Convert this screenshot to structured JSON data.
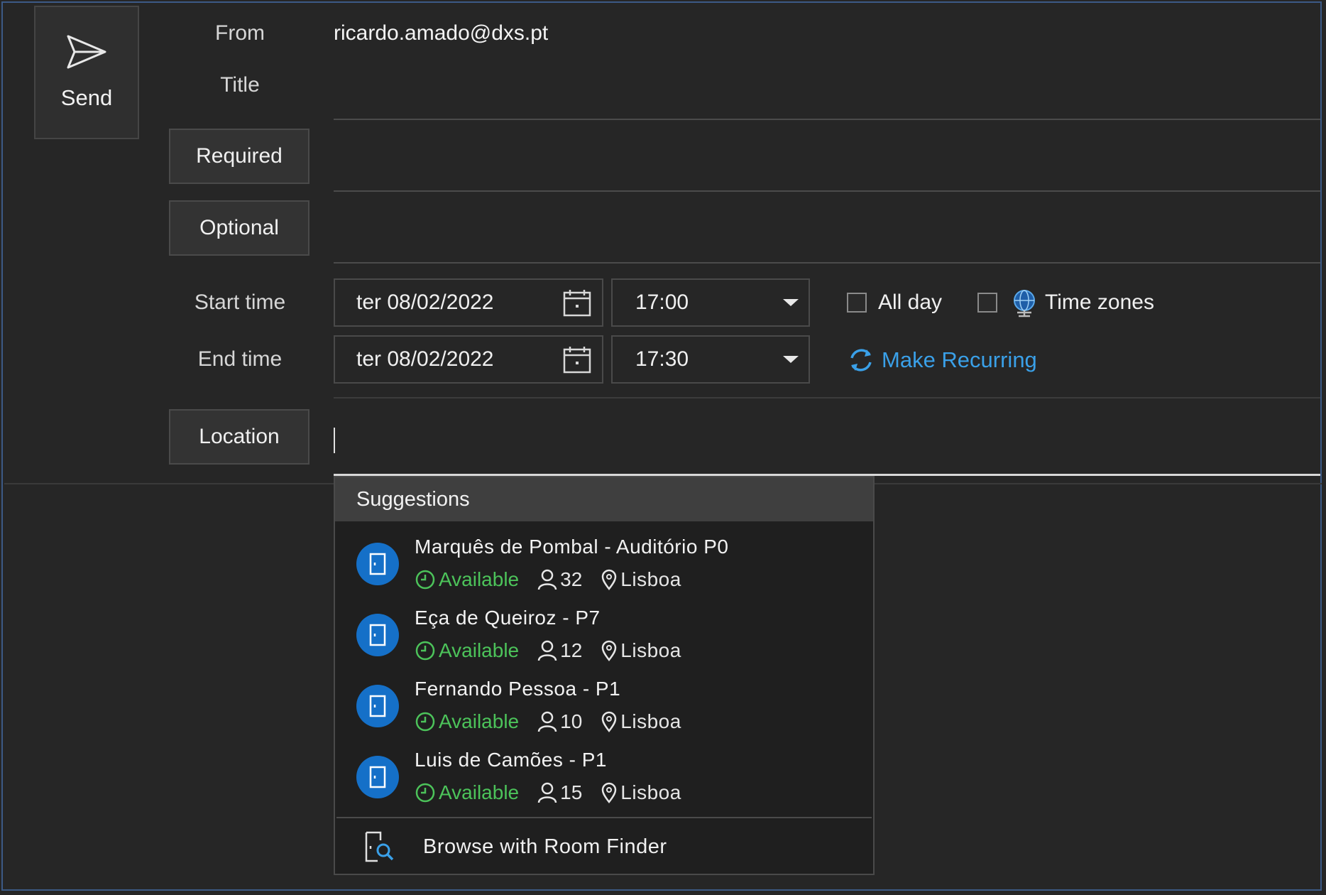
{
  "send": {
    "label": "Send"
  },
  "labels": {
    "from": "From",
    "title": "Title",
    "required": "Required",
    "optional": "Optional",
    "start_time": "Start time",
    "end_time": "End time",
    "location": "Location"
  },
  "from_value": "ricardo.amado@dxs.pt",
  "start": {
    "date": "ter 08/02/2022",
    "time": "17:00"
  },
  "end": {
    "date": "ter 08/02/2022",
    "time": "17:30"
  },
  "options": {
    "all_day": "All day",
    "time_zones": "Time zones",
    "make_recurring": "Make Recurring"
  },
  "suggestions": {
    "header": "Suggestions",
    "items": [
      {
        "name": "Marquês de Pombal - Auditório P0",
        "status": "Available",
        "capacity": "32",
        "city": "Lisboa"
      },
      {
        "name": "Eça de Queiroz - P7",
        "status": "Available",
        "capacity": "12",
        "city": "Lisboa"
      },
      {
        "name": "Fernando Pessoa - P1",
        "status": "Available",
        "capacity": "10",
        "city": "Lisboa"
      },
      {
        "name": "Luis de Camões - P1",
        "status": "Available",
        "capacity": "15",
        "city": "Lisboa"
      }
    ],
    "browse": "Browse with Room Finder"
  },
  "colors": {
    "accent": "#1570c8",
    "available": "#4cc35a",
    "link": "#3aa0e8"
  }
}
